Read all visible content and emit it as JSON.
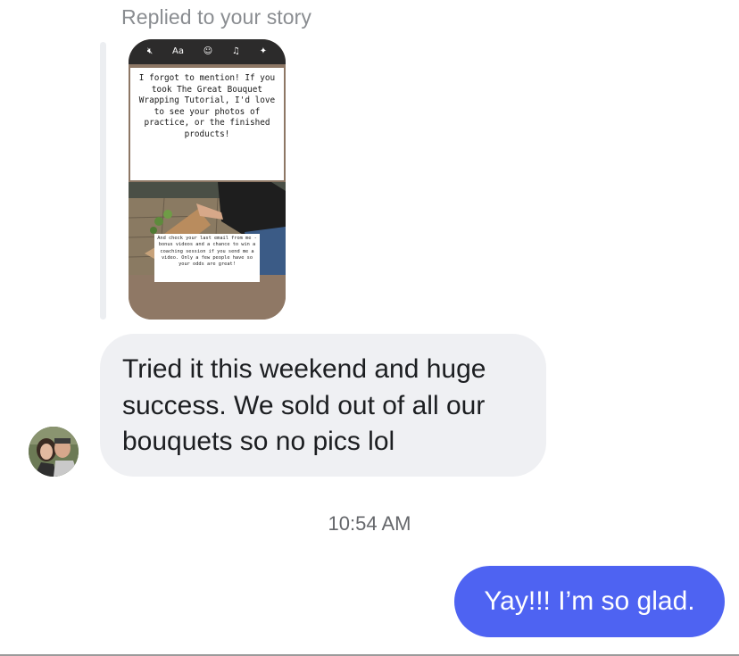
{
  "conversation": {
    "replied_label": "Replied to your story",
    "story": {
      "toolbar_icons": [
        "mute-icon",
        "text-icon",
        "sticker-icon",
        "music-icon",
        "effects-icon"
      ],
      "toolbar_glyphs": {
        "mute": "🔇︎",
        "text": "Aa",
        "sticker": "☺",
        "music": "♫",
        "effects": "✦"
      },
      "caption": "I forgot to mention! If you took The Great Bouquet Wrapping Tutorial, I'd love to see your photos of practice, or the finished products!",
      "note": "And check your last email from me - bonus videos and a chance to win a coaching session if you send me a video. Only a few people have so your odds are great!"
    },
    "incoming_message": "Tried it this weekend and huge success. We sold out of all our bouquets so no pics lol",
    "timestamp": "10:54 AM",
    "outgoing_message": "Yay!!! I’m so glad."
  },
  "colors": {
    "incoming_bubble": "#eff0f3",
    "outgoing_bubble": "#4e63f2",
    "secondary_text": "#8a8d91"
  }
}
